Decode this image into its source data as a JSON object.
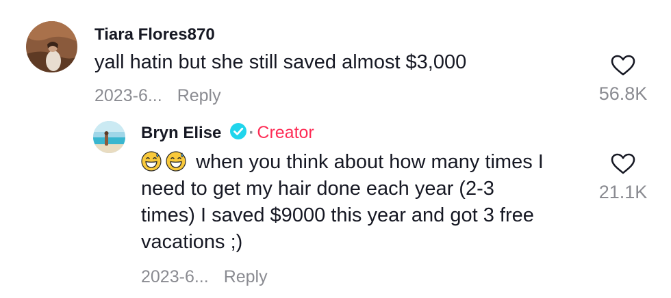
{
  "comments": [
    {
      "username": "Tiara Flores870",
      "text": "yall hatin but she still saved almost $3,000",
      "date": "2023-6...",
      "reply_label": "Reply",
      "likes": "56.8K",
      "avatar_icon": "user-avatar"
    }
  ],
  "reply": {
    "username": "Bryn Elise",
    "verified_icon": "verified-check-icon",
    "separator": "·",
    "badge": "Creator",
    "emojis": [
      "grinning-sweat-emoji",
      "grinning-sweat-emoji"
    ],
    "text_lines": [
      "when you think about how many times I",
      "need to get my hair done each year (2-3",
      "times) I saved $9000 this year and got 3 free",
      "vacations ;)"
    ],
    "date": "2023-6...",
    "reply_label": "Reply",
    "likes": "21.1K",
    "avatar_icon": "creator-avatar"
  },
  "colors": {
    "text": "#161823",
    "muted": "#8a8b91",
    "creator": "#fe2c55",
    "verified": "#20d5ec"
  }
}
